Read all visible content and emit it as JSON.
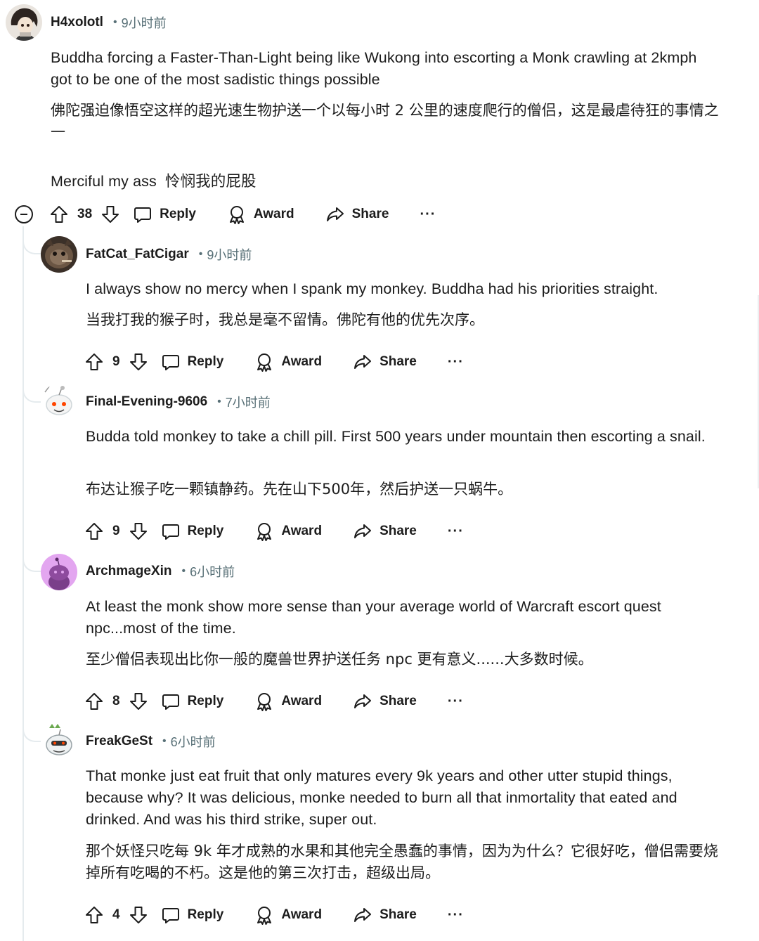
{
  "main_comment": {
    "username": "H4xolotl",
    "time": "9小时前",
    "text_en": "Buddha forcing a Faster-Than-Light being like Wukong into escorting a Monk crawling at 2kmph got to be one of the most sadistic things possible",
    "text_cn": "佛陀强迫像悟空这样的超光速生物护送一个以每小时 2 公里的速度爬行的僧侣，这是最虐待狂的事情之一",
    "text_extra": "Merciful my ass  怜悯我的屁股",
    "score": "38"
  },
  "replies": [
    {
      "username": "FatCat_FatCigar",
      "time": "9小时前",
      "text_en": "I always show no mercy when I spank my monkey. Buddha had his priorities straight.",
      "text_cn": "当我打我的猴子时，我总是毫不留情。佛陀有他的优先次序。",
      "score": "9"
    },
    {
      "username": "Final-Evening-9606",
      "time": "7小时前",
      "text_en": "Budda told monkey to take a chill pill. First 500 years under mountain then escorting a snail.",
      "text_cn": "布达让猴子吃一颗镇静药。先在山下500年，然后护送一只蜗牛。",
      "score": "9"
    },
    {
      "username": "ArchmageXin",
      "time": "6小时前",
      "text_en": "At least the monk show more sense than your average world of Warcraft escort quest npc...most of the time.",
      "text_cn": "至少僧侣表现出比你一般的魔兽世界护送任务 npc 更有意义......大多数时候。",
      "score": "8"
    },
    {
      "username": "FreakGeSt",
      "time": "6小时前",
      "text_en": "That monke just eat fruit that only matures every 9k years and other utter stupid things, because why? It was delicious, monke needed to burn all that inmortality that eated and drinked. And was his third strike, super out.",
      "text_cn": "那个妖怪只吃每 9k 年才成熟的水果和其他完全愚蠢的事情，因为为什么？它很好吃，僧侣需要烧掉所有吃喝的不朽。这是他的第三次打击，超级出局。",
      "score": "4"
    }
  ],
  "labels": {
    "separator": "•",
    "reply": "Reply",
    "award": "Award",
    "share": "Share",
    "more": "···"
  },
  "icons": {
    "upvote": "upvote-icon",
    "downvote": "downvote-icon",
    "reply": "comment-bubble-icon",
    "award": "award-ribbon-icon",
    "share": "share-arrow-icon",
    "collapse": "collapse-minus-icon"
  },
  "colors": {
    "text": "#1c1c1c",
    "meta": "#576f76",
    "thread_line": "#e5ebee"
  }
}
